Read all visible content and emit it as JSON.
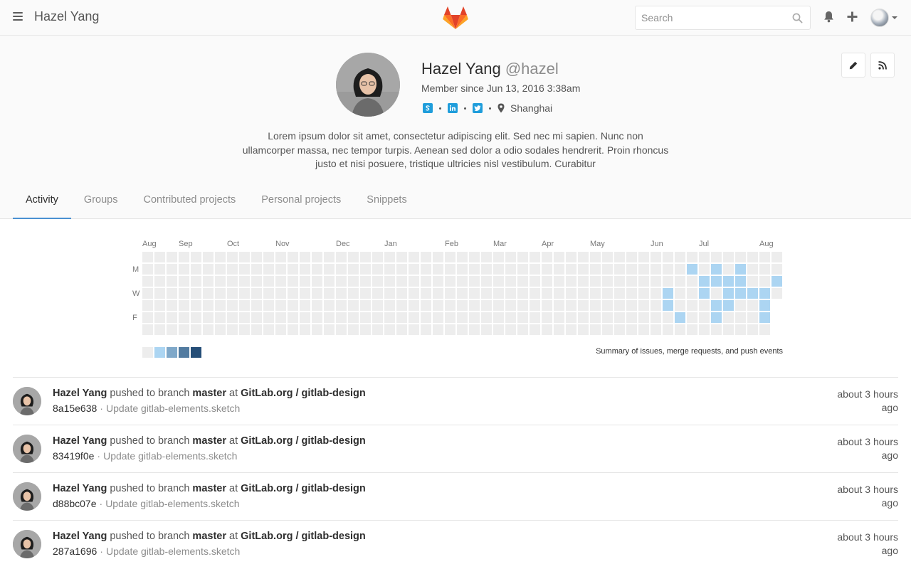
{
  "header": {
    "title": "Hazel Yang",
    "search_placeholder": "Search",
    "icons": [
      "menu-icon",
      "gitlab-logo",
      "search-icon",
      "bell-icon",
      "plus-icon",
      "user-avatar"
    ]
  },
  "profile": {
    "name": "Hazel Yang",
    "username": "@hazel",
    "member_since": "Member since Jun 13, 2016 3:38am",
    "social_icons": [
      "skype-icon",
      "linkedin-icon",
      "twitter-icon"
    ],
    "location": "Shanghai",
    "bio": "Lorem ipsum dolor sit amet, consectetur adipiscing elit. Sed nec mi sapien. Nunc non ullamcorper massa, nec tempor turpis. Aenean sed dolor a odio sodales hendrerit. Proin rhoncus justo et nisi posuere, tristique ultricies nisl vestibulum. Curabitur",
    "action_icons": [
      "edit-icon",
      "rss-icon"
    ]
  },
  "tabs": [
    {
      "label": "Activity",
      "active": true
    },
    {
      "label": "Groups",
      "active": false
    },
    {
      "label": "Contributed projects",
      "active": false
    },
    {
      "label": "Personal projects",
      "active": false
    },
    {
      "label": "Snippets",
      "active": false
    }
  ],
  "calendar": {
    "months": [
      "Aug",
      "Sep",
      "Oct",
      "Nov",
      "Dec",
      "Jan",
      "Feb",
      "Mar",
      "Apr",
      "May",
      "Jun",
      "Jul",
      "Aug"
    ],
    "day_labels": [
      "",
      "M",
      "",
      "W",
      "",
      "F",
      ""
    ],
    "weeks": 53,
    "last_week_days": 4,
    "contributions": [
      {
        "week": 43,
        "day": 3,
        "level": 1
      },
      {
        "week": 43,
        "day": 4,
        "level": 1
      },
      {
        "week": 44,
        "day": 5,
        "level": 1
      },
      {
        "week": 45,
        "day": 1,
        "level": 1
      },
      {
        "week": 46,
        "day": 2,
        "level": 1
      },
      {
        "week": 46,
        "day": 3,
        "level": 1
      },
      {
        "week": 47,
        "day": 1,
        "level": 1
      },
      {
        "week": 47,
        "day": 2,
        "level": 1
      },
      {
        "week": 47,
        "day": 4,
        "level": 1
      },
      {
        "week": 47,
        "day": 5,
        "level": 1
      },
      {
        "week": 48,
        "day": 2,
        "level": 1
      },
      {
        "week": 48,
        "day": 3,
        "level": 1
      },
      {
        "week": 48,
        "day": 4,
        "level": 1
      },
      {
        "week": 49,
        "day": 1,
        "level": 1
      },
      {
        "week": 49,
        "day": 2,
        "level": 1
      },
      {
        "week": 49,
        "day": 3,
        "level": 1
      },
      {
        "week": 50,
        "day": 3,
        "level": 1
      },
      {
        "week": 51,
        "day": 3,
        "level": 1
      },
      {
        "week": 51,
        "day": 4,
        "level": 1
      },
      {
        "week": 51,
        "day": 5,
        "level": 1
      },
      {
        "week": 52,
        "day": 2,
        "level": 1
      }
    ],
    "legend_colors": [
      "#ededed",
      "#acd5f2",
      "#7fa8c9",
      "#527ba0",
      "#254e77"
    ],
    "summary": "Summary of issues, merge requests, and push events"
  },
  "events": [
    {
      "author": "Hazel Yang",
      "action": "pushed to branch",
      "branch": "master",
      "at": "at",
      "project": "GitLab.org / gitlab-design",
      "sha": "8a15e638",
      "message": "Update gitlab-elements.sketch",
      "time": "about 3 hours ago"
    },
    {
      "author": "Hazel Yang",
      "action": "pushed to branch",
      "branch": "master",
      "at": "at",
      "project": "GitLab.org / gitlab-design",
      "sha": "83419f0e",
      "message": "Update gitlab-elements.sketch",
      "time": "about 3 hours ago"
    },
    {
      "author": "Hazel Yang",
      "action": "pushed to branch",
      "branch": "master",
      "at": "at",
      "project": "GitLab.org / gitlab-design",
      "sha": "d88bc07e",
      "message": "Update gitlab-elements.sketch",
      "time": "about 3 hours ago"
    },
    {
      "author": "Hazel Yang",
      "action": "pushed to branch",
      "branch": "master",
      "at": "at",
      "project": "GitLab.org / gitlab-design",
      "sha": "287a1696",
      "message": "Update gitlab-elements.sketch",
      "time": "about 3 hours ago"
    }
  ]
}
